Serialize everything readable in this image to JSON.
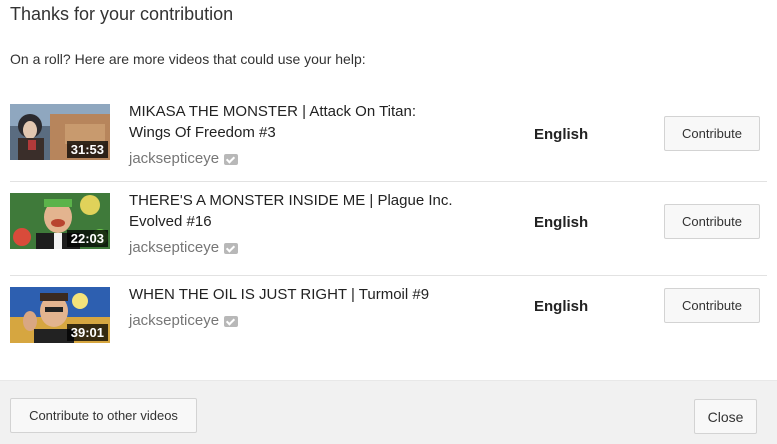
{
  "dialog": {
    "title": "Thanks for your contribution",
    "subtitle": "On a roll? Here are more videos that could use your help:"
  },
  "videos": [
    {
      "title": "MIKASA THE MONSTER | Attack On Titan: Wings Of Freedom #3",
      "channel": "jacksepticeye",
      "duration": "31:53",
      "language": "English",
      "button": "Contribute",
      "thumbnail_icon": "video-thumbnail"
    },
    {
      "title": "THERE'S A MONSTER INSIDE ME | Plague Inc. Evolved #16",
      "channel": "jacksepticeye",
      "duration": "22:03",
      "language": "English",
      "button": "Contribute",
      "thumbnail_icon": "video-thumbnail"
    },
    {
      "title": "WHEN THE OIL IS JUST RIGHT | Turmoil #9",
      "channel": "jacksepticeye",
      "duration": "39:01",
      "language": "English",
      "button": "Contribute",
      "thumbnail_icon": "video-thumbnail"
    }
  ],
  "footer": {
    "other_button": "Contribute to other videos",
    "close_button": "Close"
  },
  "colors": {
    "footer_bg": "#f1f1f1",
    "button_bg": "#f8f8f8",
    "channel_text": "#767676"
  }
}
